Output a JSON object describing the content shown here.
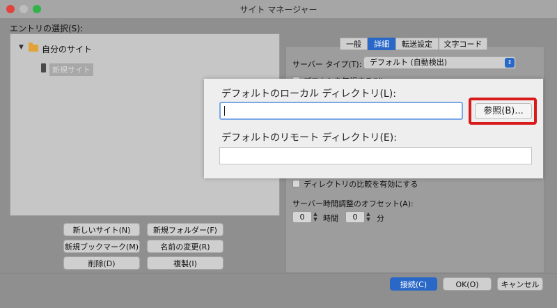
{
  "window": {
    "title": "サイト マネージャー"
  },
  "colors": {
    "close": "#e0443e",
    "minimize": "#bdbdbd",
    "zoom": "#31b34a",
    "accent": "#2a68c8",
    "highlight": "#d81a1a"
  },
  "entries": {
    "label": "エントリの選択(S):",
    "tree": {
      "folder_label": "自分のサイト",
      "site_label": "新規サイト"
    }
  },
  "left_buttons": {
    "new_site": "新しいサイト(N)",
    "new_folder": "新規フォルダー(F)",
    "new_bookmark": "新規ブックマーク(M)",
    "rename": "名前の変更(R)",
    "delete": "削除(D)",
    "duplicate": "複製(I)"
  },
  "tabs": [
    {
      "label": "一般",
      "active": false
    },
    {
      "label": "詳細",
      "active": true
    },
    {
      "label": "転送設定",
      "active": false
    },
    {
      "label": "文字コード",
      "active": false
    }
  ],
  "advanced": {
    "server_type_label": "サーバー タイプ(T):",
    "server_type_value": "デフォルト (自動検出)",
    "bypass_proxy": "プロキシを無視する(Y)",
    "dir_comparison": "ディレクトリの比較を有効にする",
    "offset_label": "サーバー時間調整のオフセット(A):",
    "hours_value": "0",
    "hours_unit": "時間",
    "minutes_value": "0",
    "minutes_unit": "分"
  },
  "zoom": {
    "local_dir_label": "デフォルトのローカル ディレクトリ(L):",
    "local_dir_value": "",
    "browse_button": "参照(B)...",
    "remote_dir_label": "デフォルトのリモート ディレクトリ(E):",
    "remote_dir_value": ""
  },
  "footer": {
    "connect": "接続(C)",
    "ok": "OK(O)",
    "cancel": "キャンセル"
  }
}
